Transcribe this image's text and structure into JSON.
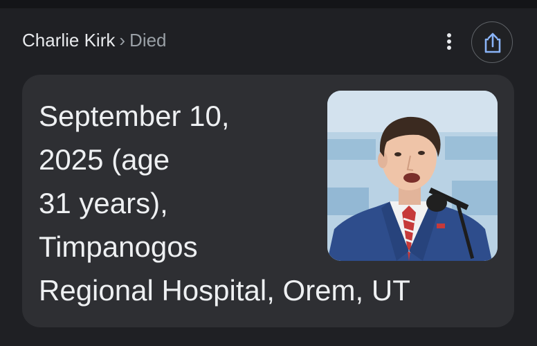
{
  "breadcrumb": {
    "entity": "Charlie Kirk",
    "separator": "›",
    "attribute": "Died"
  },
  "header": {
    "more_icon": "more-vert-icon",
    "share_icon": "share-icon"
  },
  "answer": {
    "text": "September 10,\n2025 (age\n31 years),\nTimpanogos\nRegional Hospital, Orem, UT"
  },
  "photo": {
    "alt": "Charlie Kirk",
    "background_color": "#b8d1e3",
    "suit_color": "#2e4d8c"
  },
  "colors": {
    "page_background": "#1f2024",
    "card_background": "#2e2f33",
    "primary_text": "#e8eaed",
    "secondary_text": "#9aa0a6"
  }
}
